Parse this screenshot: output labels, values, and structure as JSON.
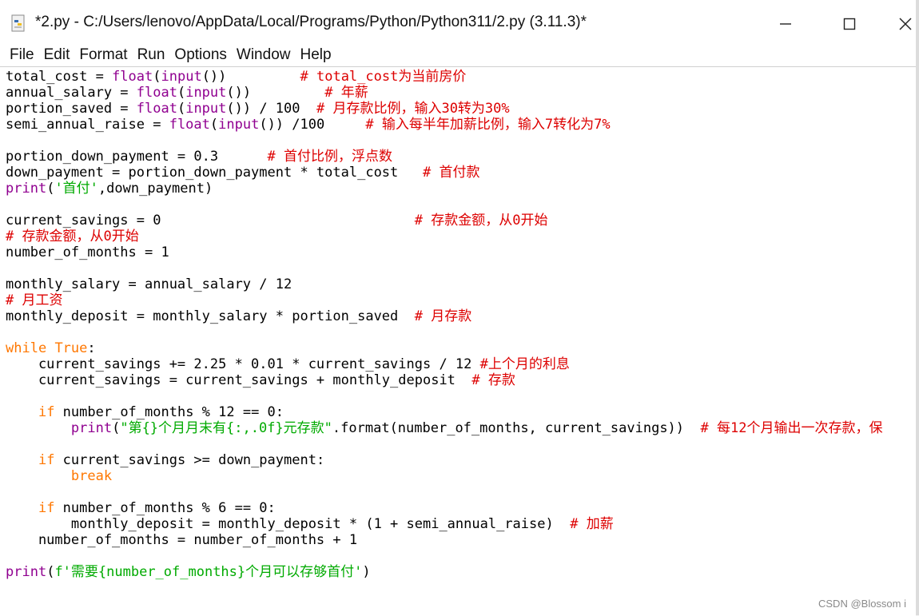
{
  "window": {
    "title": "*2.py - C:/Users/lenovo/AppData/Local/Programs/Python/Python311/2.py (3.11.3)*"
  },
  "menu": [
    "File",
    "Edit",
    "Format",
    "Run",
    "Options",
    "Window",
    "Help"
  ],
  "code_lines": [
    [
      [
        "total_cost = ",
        ""
      ],
      [
        "float",
        "bi"
      ],
      [
        "(",
        ""
      ],
      [
        "input",
        "bi"
      ],
      [
        "())         ",
        ""
      ],
      [
        "# total_cost为当前房价",
        "cm"
      ]
    ],
    [
      [
        "annual_salary = ",
        ""
      ],
      [
        "float",
        "bi"
      ],
      [
        "(",
        ""
      ],
      [
        "input",
        "bi"
      ],
      [
        "())         ",
        ""
      ],
      [
        "# 年薪",
        "cm"
      ]
    ],
    [
      [
        "portion_saved = ",
        ""
      ],
      [
        "float",
        "bi"
      ],
      [
        "(",
        ""
      ],
      [
        "input",
        "bi"
      ],
      [
        "()) / 100  ",
        ""
      ],
      [
        "# 月存款比例，输入30转为30%",
        "cm"
      ]
    ],
    [
      [
        "semi_annual_raise = ",
        ""
      ],
      [
        "float",
        "bi"
      ],
      [
        "(",
        ""
      ],
      [
        "input",
        "bi"
      ],
      [
        "()) /100     ",
        ""
      ],
      [
        "# 输入每半年加薪比例，输入7转化为7%",
        "cm"
      ]
    ],
    [],
    [
      [
        "portion_down_payment = 0.3      ",
        ""
      ],
      [
        "# 首付比例，浮点数",
        "cm"
      ]
    ],
    [
      [
        "down_payment = portion_down_payment * total_cost   ",
        ""
      ],
      [
        "# 首付款",
        "cm"
      ]
    ],
    [
      [
        "print",
        "bi"
      ],
      [
        "(",
        ""
      ],
      [
        "'首付'",
        "st"
      ],
      [
        ",down_payment)",
        ""
      ]
    ],
    [],
    [
      [
        "current_savings = 0                               ",
        ""
      ],
      [
        "# 存款金额，从0开始",
        "cm"
      ]
    ],
    [
      [
        "# 存款金额，从0开始",
        "cm"
      ]
    ],
    [
      [
        "number_of_months = 1",
        ""
      ]
    ],
    [],
    [
      [
        "monthly_salary = annual_salary / 12",
        ""
      ]
    ],
    [
      [
        "# 月工资",
        "cm"
      ]
    ],
    [
      [
        "monthly_deposit = monthly_salary * portion_saved  ",
        ""
      ],
      [
        "# 月存款",
        "cm"
      ]
    ],
    [],
    [
      [
        "while",
        "kw"
      ],
      [
        " ",
        ""
      ],
      [
        "True",
        "kw"
      ],
      [
        ":",
        ""
      ]
    ],
    [
      [
        "    current_savings += 2.25 * 0.01 * current_savings / 12 ",
        ""
      ],
      [
        "#上个月的利息",
        "cm"
      ]
    ],
    [
      [
        "    current_savings = current_savings + monthly_deposit  ",
        ""
      ],
      [
        "# 存款",
        "cm"
      ]
    ],
    [],
    [
      [
        "    ",
        ""
      ],
      [
        "if",
        "kw"
      ],
      [
        " number_of_months % 12 == 0:",
        ""
      ]
    ],
    [
      [
        "        ",
        ""
      ],
      [
        "print",
        "bi"
      ],
      [
        "(",
        ""
      ],
      [
        "\"第{}个月月末有{:,.0f}元存款\"",
        "st"
      ],
      [
        ".format(number_of_months, current_savings))  ",
        ""
      ],
      [
        "# 每12个月输出一次存款，保",
        "cm"
      ]
    ],
    [],
    [
      [
        "    ",
        ""
      ],
      [
        "if",
        "kw"
      ],
      [
        " current_savings >= down_payment:",
        ""
      ]
    ],
    [
      [
        "        ",
        ""
      ],
      [
        "break",
        "kw"
      ]
    ],
    [],
    [
      [
        "    ",
        ""
      ],
      [
        "if",
        "kw"
      ],
      [
        " number_of_months % 6 == 0:",
        ""
      ]
    ],
    [
      [
        "        monthly_deposit = monthly_deposit * (1 + semi_annual_raise)  ",
        ""
      ],
      [
        "# 加薪",
        "cm"
      ]
    ],
    [
      [
        "    number_of_months = number_of_months + 1",
        ""
      ]
    ],
    [],
    [
      [
        "print",
        "bi"
      ],
      [
        "(",
        ""
      ],
      [
        "f'需要{number_of_months}个月可以存够首付'",
        "st"
      ],
      [
        ")",
        ""
      ]
    ]
  ],
  "watermark": "CSDN @Blossom i",
  "colors": {
    "keyword": "#ff7700",
    "builtin": "#900090",
    "comment": "#dd0000",
    "string": "#00aa00"
  },
  "icons": [
    "python-file-icon",
    "minimize-icon",
    "maximize-icon",
    "close-icon"
  ]
}
